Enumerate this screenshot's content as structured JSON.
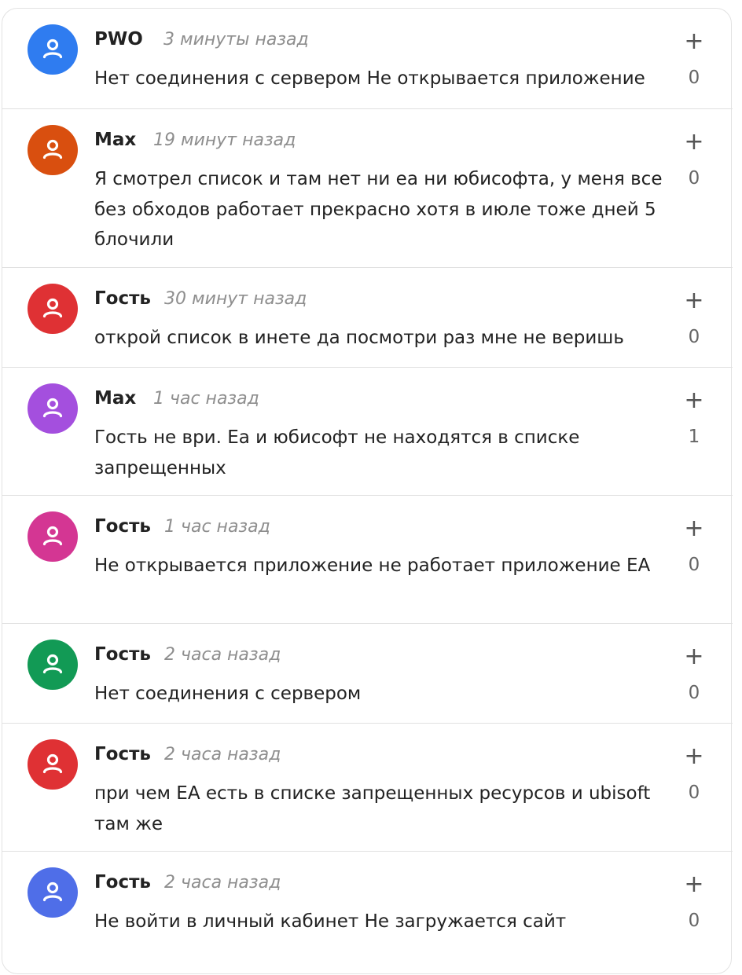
{
  "comments": [
    {
      "author": "PWO",
      "time": "3 минуты назад",
      "text": "Нет соединения с сервером Не открывается приложение",
      "votes": "0",
      "plus": "+",
      "avatar_color": "#2f7cf0"
    },
    {
      "author": "Max",
      "time": "19 минут назад",
      "text": "Я смотрел список и там нет ни еа ни юбисофта, у меня все без обходов работает прекрасно хотя в июле тоже дней 5 блочили",
      "votes": "0",
      "plus": "+",
      "avatar_color": "#d94f0f"
    },
    {
      "author": "Гость",
      "time": "30 минут назад",
      "text": "открой список в инете да посмотри раз мне не веришь",
      "votes": "0",
      "plus": "+",
      "avatar_color": "#df3134"
    },
    {
      "author": "Max",
      "time": "1 час назад",
      "text": "Гость не ври. Еа и юбисофт не находятся в списке запрещенных",
      "votes": "1",
      "plus": "+",
      "avatar_color": "#a44fde"
    },
    {
      "author": "Гость",
      "time": "1 час назад",
      "text": "Не открывается приложение не работает приложение EA",
      "votes": "0",
      "plus": "+",
      "avatar_color": "#d43693"
    },
    {
      "author": "Гость",
      "time": "2 часа назад",
      "text": "Нет соединения с сервером",
      "votes": "0",
      "plus": "+",
      "avatar_color": "#129a55"
    },
    {
      "author": "Гость",
      "time": "2 часа назад",
      "text": "при чем EA есть в списке запрещенных ресурсов и ubisoft там же",
      "votes": "0",
      "plus": "+",
      "avatar_color": "#df3134"
    },
    {
      "author": "Гость",
      "time": "2 часа назад",
      "text": "Не войти в личный кабинет Не загружается сайт",
      "votes": "0",
      "plus": "+",
      "avatar_color": "#4f6ee8"
    }
  ],
  "icons": {
    "avatar": "user-icon",
    "upvote": "plus-icon"
  }
}
